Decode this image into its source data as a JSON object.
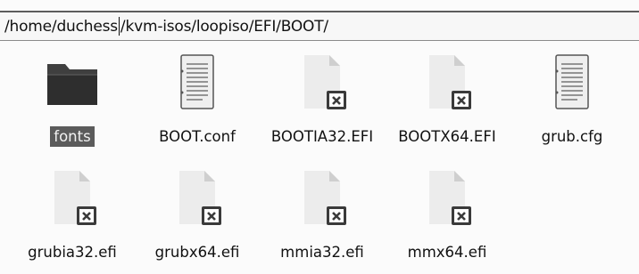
{
  "location": {
    "path_before_caret": "/home/duchess",
    "path_after_caret": "/kvm-isos/loopiso/EFI/BOOT/"
  },
  "files": [
    {
      "name": "fonts",
      "icon": "folder-icon",
      "selected": true
    },
    {
      "name": "BOOT.conf",
      "icon": "text-file-icon",
      "selected": false
    },
    {
      "name": "BOOTIA32.EFI",
      "icon": "binary-file-icon",
      "selected": false
    },
    {
      "name": "BOOTX64.EFI",
      "icon": "binary-file-icon",
      "selected": false
    },
    {
      "name": "grub.cfg",
      "icon": "text-file-icon",
      "selected": false
    },
    {
      "name": "grubia32.efi",
      "icon": "binary-file-icon",
      "selected": false
    },
    {
      "name": "grubx64.efi",
      "icon": "binary-file-icon",
      "selected": false
    },
    {
      "name": "mmia32.efi",
      "icon": "binary-file-icon",
      "selected": false
    },
    {
      "name": "mmx64.efi",
      "icon": "binary-file-icon",
      "selected": false
    }
  ]
}
